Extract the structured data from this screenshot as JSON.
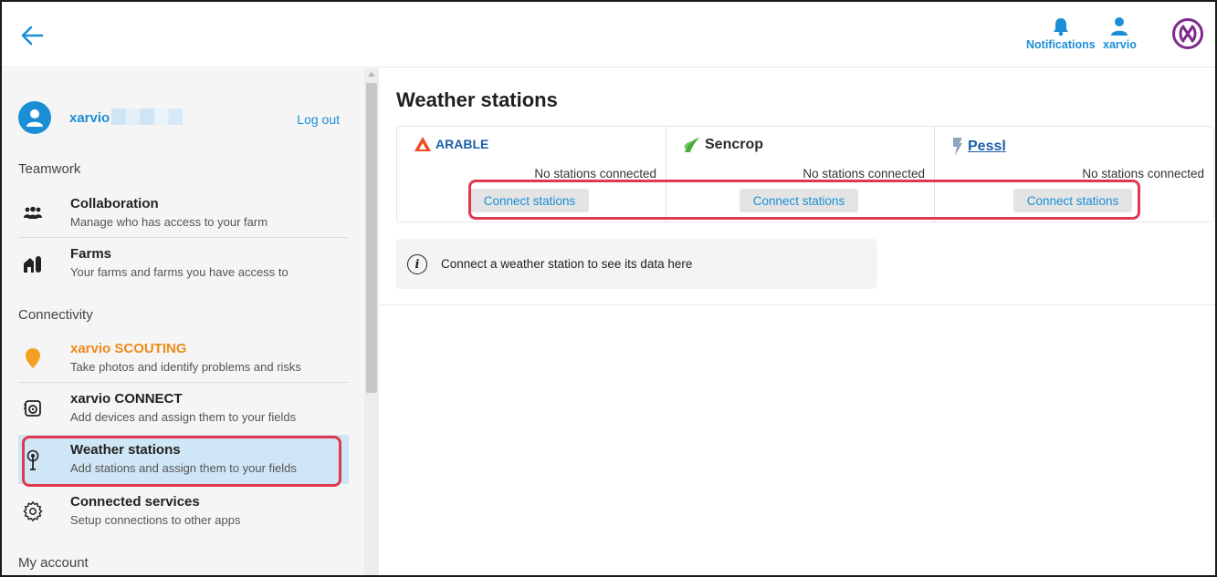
{
  "topbar": {
    "notifications_label": "Notifications",
    "account_label": "xarvio",
    "accent_color": "#1a8fd6",
    "logo_color": "#7d2a8a"
  },
  "sidebar": {
    "user": {
      "name": "xarvio",
      "logout_label": "Log out"
    },
    "sections": {
      "teamwork": "Teamwork",
      "connectivity": "Connectivity",
      "my_account": "My account"
    },
    "items": [
      {
        "title": "Collaboration",
        "desc": "Manage who has access to your farm",
        "icon": "people-icon"
      },
      {
        "title": "Farms",
        "desc": "Your farms and farms you have access to",
        "icon": "barn-icon"
      },
      {
        "title": "xarvio SCOUTING",
        "desc": "Take photos and identify problems and risks",
        "icon": "scouting-pin-icon"
      },
      {
        "title": "xarvio CONNECT",
        "desc": "Add devices and assign them to your fields",
        "icon": "connect-device-icon"
      },
      {
        "title": "Weather stations",
        "desc": "Add stations and assign them to your fields",
        "icon": "antenna-icon"
      },
      {
        "title": "Connected services",
        "desc": "Setup connections to other apps",
        "icon": "gear-icon"
      }
    ]
  },
  "main": {
    "title": "Weather stations",
    "providers": [
      {
        "name": "ARABLE",
        "status": "No stations connected",
        "button": "Connect stations",
        "color": "#ef4b23"
      },
      {
        "name": "Sencrop",
        "status": "No stations connected",
        "button": "Connect stations",
        "color": "#4caf3c"
      },
      {
        "name": "Pessl",
        "status": "No stations connected",
        "button": "Connect stations",
        "color": "#1b5fa8"
      }
    ],
    "info": "Connect a weather station to see its data here"
  }
}
